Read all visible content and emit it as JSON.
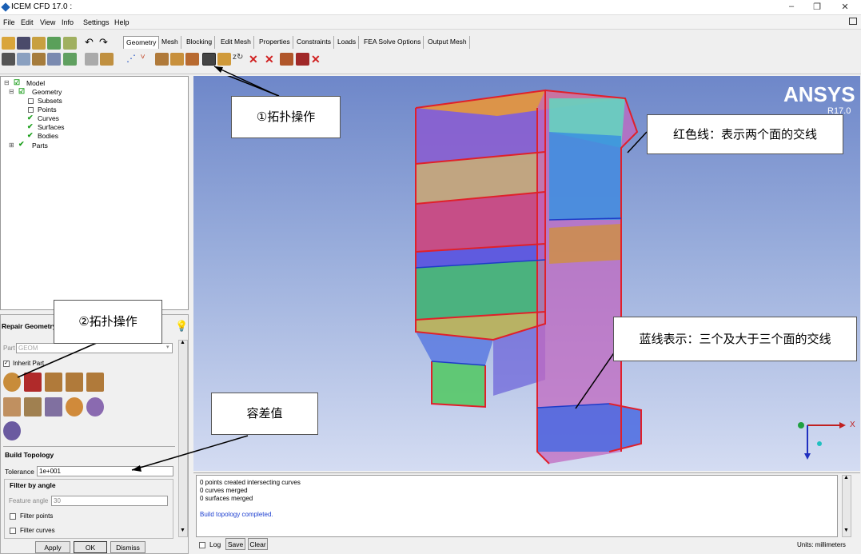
{
  "window": {
    "title": "ICEM CFD 17.0 :",
    "min": "–",
    "max": "❐",
    "close": "✕"
  },
  "menu": [
    "File",
    "Edit",
    "View",
    "Info",
    "Settings",
    "Help"
  ],
  "tabs": [
    "Geometry",
    "Mesh",
    "Blocking",
    "Edit Mesh",
    "Properties",
    "Constraints",
    "Loads",
    "FEA Solve Options",
    "Output Mesh"
  ],
  "tree": {
    "model": "Model",
    "geometry": "Geometry",
    "subsets": "Subsets",
    "points": "Points",
    "curves": "Curves",
    "surfaces": "Surfaces",
    "bodies": "Bodies",
    "parts": "Parts"
  },
  "repair": {
    "title": "Repair Geometry",
    "part_label": "Part",
    "part_value": "GEOM",
    "inherit_label": "Inherit Part",
    "build_topology": "Build Topology",
    "tolerance_label": "Tolerance",
    "tolerance_value": "1e+001",
    "filter_by_angle": "Filter by angle",
    "feature_angle_label": "Feature angle",
    "feature_angle_value": "30",
    "filter_points": "Filter points",
    "filter_curves": "Filter curves",
    "apply": "Apply",
    "ok": "OK",
    "dismiss": "Dismiss"
  },
  "viewport": {
    "brand": "ANSYS",
    "version": "R17.0",
    "axis_x": "X"
  },
  "messages": [
    "0 points created intersecting curves",
    "0 curves merged",
    "0 surfaces merged",
    "",
    "Build topology completed."
  ],
  "bottom": {
    "log": "Log",
    "save": "Save",
    "clear": "Clear",
    "units": "Units: millimeters"
  },
  "callouts": {
    "topo1": "①拓扑操作",
    "topo2": "②拓扑操作",
    "red_line": "红色线：表示两个面的交线",
    "blue_line": "蓝线表示：三个及大于三个面的交线",
    "tolerance": "容差值"
  },
  "colors": {
    "accent_blue": "#1a5fb4",
    "red_curve": "#e0202a",
    "blue_curve": "#1e3cc8",
    "message_blue": "#1d3fd0"
  }
}
